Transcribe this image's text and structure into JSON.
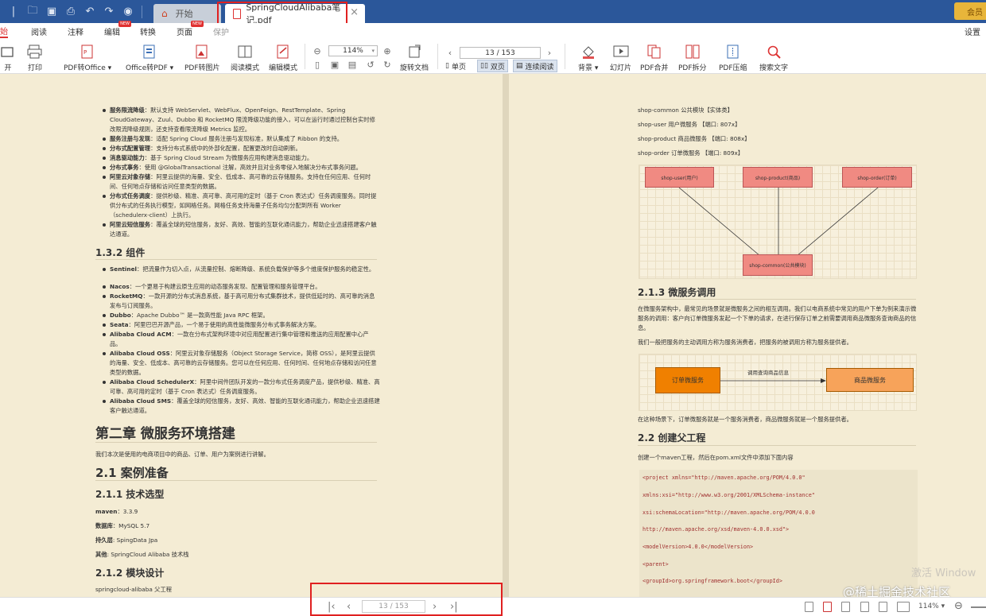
{
  "window": {
    "tabs": [
      {
        "label": "开始"
      },
      {
        "label": "SpringCloudAlibaba笔记.pdf"
      }
    ],
    "vip_label": "会员"
  },
  "menu": {
    "items": [
      "始",
      "阅读",
      "注释",
      "编辑",
      "转换",
      "页面",
      "保护"
    ],
    "new_badge": "NEW",
    "settings": "设置"
  },
  "toolbar": {
    "open": "开",
    "print": "打印",
    "pdf_to_office": "PDF转Office",
    "office_to_pdf": "Office转PDF",
    "pdf_to_image": "PDF转图片",
    "read_mode": "阅读模式",
    "edit_mode": "编辑模式",
    "zoom": "114%",
    "page": "13 / 153",
    "rotate": "旋转文档",
    "single": "单页",
    "double": "双页",
    "continuous": "连续阅读",
    "background": "背景",
    "slideshow": "幻灯片",
    "merge": "PDF合并",
    "split": "PDF拆分",
    "compress": "PDF压缩",
    "search": "搜索文字"
  },
  "left_page": {
    "bullets1": [
      {
        "b": "服务限流降级",
        "t": "：默认支持 WebServlet、WebFlux、OpenFeign、RestTemplate、Spring CloudGateway、Zuul、Dubbo 和 RocketMQ 限流降级功能的接入，可以在运行时通过控制台实时修改限流降级规则，还支持查看限流降级 Metrics 监控。"
      },
      {
        "b": "服务注册与发现",
        "t": "：适配 Spring Cloud 服务注册与发现标准，默认集成了 Ribbon 的支持。"
      },
      {
        "b": "分布式配置管理",
        "t": "：支持分布式系统中的外部化配置，配置更改时自动刷新。"
      },
      {
        "b": "消息驱动能力",
        "t": "：基于 Spring Cloud Stream 为微服务应用构建消息驱动能力。"
      },
      {
        "b": "分布式事务",
        "t": "：使用 @GlobalTransactional 注解，高效并且对业务零侵入地解决分布式事务问题。"
      },
      {
        "b": "阿里云对象存储",
        "t": "：阿里云提供的海量、安全、低成本、高可靠的云存储服务。支持在任何应用、任何时间、任何地点存储和访问任意类型的数据。"
      },
      {
        "b": "分布式任务调度",
        "t": "：提供秒级、精准、高可靠、高可用的定时（基于 Cron 表达式）任务调度服务。同时提供分布式的任务执行模型，如网格任务。网格任务支持海量子任务均匀分配到所有 Worker（schedulerx-client）上执行。"
      },
      {
        "b": "阿里云短信服务",
        "t": "：覆盖全球的短信服务，友好、高效、智能的互联化通讯能力，帮助企业迅速搭建客户触达通道。"
      }
    ],
    "h_components": "1.3.2 组件",
    "bullets2": [
      {
        "b": "Sentinel",
        "t": "：把流量作为切入点，从流量控制、熔断降级、系统负载保护等多个维度保护服务的稳定性。"
      },
      {
        "b": "Nacos",
        "t": "：一个更易于构建云原生应用的动态服务发现、配置管理和服务管理平台。"
      },
      {
        "b": "RocketMQ",
        "t": "：一款开源的分布式消息系统，基于高可用分布式集群技术，提供低延时的、高可靠的消息发布与订阅服务。"
      },
      {
        "b": "Dubbo",
        "t": "：Apache Dubbo™ 是一款高性能 Java RPC 框架。"
      },
      {
        "b": "Seata",
        "t": "：阿里巴巴开源产品，一个易于使用的高性能微服务分布式事务解决方案。"
      },
      {
        "b": "Alibaba Cloud ACM",
        "t": "：一款在分布式架构环境中对应用配置进行集中管理和推送的应用配置中心产品。"
      },
      {
        "b": "Alibaba Cloud OSS",
        "t": "：阿里云对象存储服务（Object Storage Service，简称 OSS），是阿里云提供的海量、安全、低成本、高可靠的云存储服务。您可以在任何应用、任何时间、任何地点存储和访问任意类型的数据。"
      },
      {
        "b": "Alibaba Cloud SchedulerX",
        "t": "：阿里中间件团队开发的一款分布式任务调度产品，提供秒级、精准、高可靠、高可用的定时（基于 Cron 表达式）任务调度服务。"
      },
      {
        "b": "Alibaba Cloud SMS",
        "t": "：覆盖全球的短信服务，友好、高效、智能的互联化通讯能力，帮助企业迅速搭建客户触达通道。"
      }
    ],
    "chapter2": "第二章 微服务环境搭建",
    "chapter2_intro": "我们本次是使用的电商项目中的商品、订单、用户为案例进行讲解。",
    "h_case": "2.1 案例准备",
    "h_tech": "2.1.1 技术选型",
    "tech": [
      {
        "k": "maven",
        "v": "：3.3.9"
      },
      {
        "k": "数据库",
        "v": "：MySQL 5.7"
      },
      {
        "k": "持久层",
        "v": ": SpingData Jpa"
      },
      {
        "k": "其他",
        "v": ": SpringCloud Alibaba 技术栈"
      }
    ],
    "h_module": "2.1.2 模块设计",
    "module_line": "springcloud-alibaba 父工程"
  },
  "right_page": {
    "modules": [
      "shop-common 公共模块【实体类】",
      "shop-user 用户微服务 【端口: 807x】",
      "shop-product 商品微服务 【端口: 808x】",
      "shop-order 订单微服务 【端口: 809x】"
    ],
    "diagram1": {
      "user": "shop-user(用户)",
      "product": "shop-product(商品)",
      "order": "shop-order(订单)",
      "common": "shop-common(公共模块)"
    },
    "h_call": "2.1.3 微服务调用",
    "call_p1": "在微服务架构中，最常见的场景就是微服务之间的相互调用。我们以电商系统中常见的用户下单为例来演示微服务的调用：客户向订单微服务发起一个下单的请求，在进行保存订单之前需要调用商品微服务查询商品的信息。",
    "call_p2": "我们一般把服务的主动调用方称为服务消费者，把服务的被调用方称为服务提供者。",
    "diagram2": {
      "order": "订单微服务",
      "product": "商品微服务",
      "edge": "调用查询商品信息"
    },
    "call_p3": "在这种场景下，订单微服务就是一个服务消费者，商品微服务就是一个服务提供者。",
    "h_parent": "2.2 创建父工程",
    "parent_p": "创建一个maven工程，然后在pom.xml文件中添加下面内容",
    "code": [
      "<project xmlns=\"http://maven.apache.org/POM/4.0.0\"",
      "xmlns:xsi=\"http://www.w3.org/2001/XMLSchema-instance\"",
      "xsi:schemaLocation=\"http://maven.apache.org/POM/4.0.0",
      "http://maven.apache.org/xsd/maven-4.0.0.xsd\">",
      "<modelVersion>4.0.0</modelVersion>",
      "<parent>",
      "<groupId>org.springframework.boot</groupId>"
    ]
  },
  "status": {
    "page": "13 / 153",
    "zoom": "114%",
    "watermark": "@稀土掘金技术社区",
    "activate": "激活 Window"
  }
}
